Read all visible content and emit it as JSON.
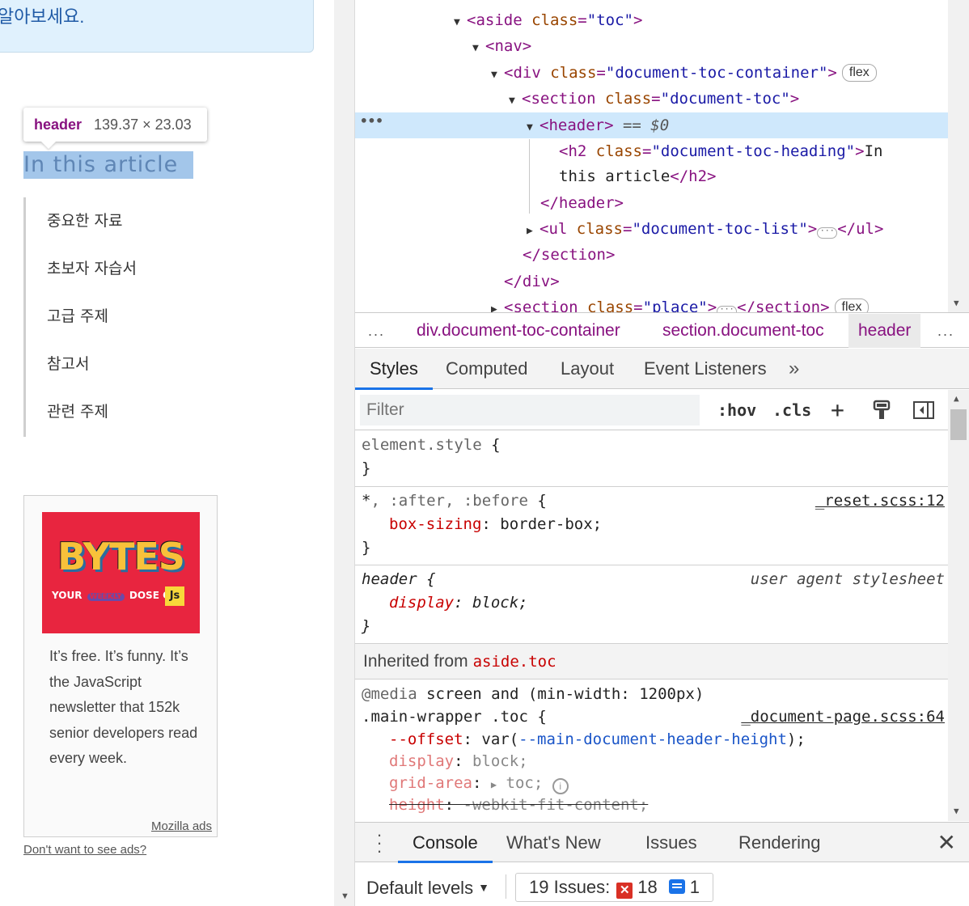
{
  "page": {
    "notice_text": "알아보세요.",
    "tooltip": {
      "tag": "header",
      "size": "139.37 × 23.03"
    },
    "toc_heading": "In this article",
    "toc_items": [
      "중요한 자료",
      "초보자 자습서",
      "고급 주제",
      "참고서",
      "관련 주제"
    ],
    "ad": {
      "brand_title": "BYTES",
      "tag_your": "YOUR",
      "tag_weekly": "WEEKLY",
      "tag_dose": "DOSE OF",
      "tag_js": "Js",
      "body": "It’s free. It’s funny. It’s the JavaScript newsletter that 152k senior developers read every week.",
      "sponsor": "Mozilla ads"
    },
    "ad_optout": "Don't want to see ads?"
  },
  "devtools": {
    "elements": {
      "l1": {
        "tag_open": "<aside",
        "attr": "class",
        "val": "\"toc\"",
        "close": ">"
      },
      "l2": {
        "tag": "<nav>"
      },
      "l3": {
        "tag_open": "<div",
        "attr": "class",
        "val": "\"document-toc-container\"",
        "close": ">",
        "badge": "flex"
      },
      "l4": {
        "tag_open": "<section",
        "attr": "class",
        "val": "\"document-toc\"",
        "close": ">"
      },
      "l5": {
        "tag": "<header>",
        "eq": "== $0"
      },
      "l6": {
        "tag_open": "<h2",
        "attr": "class",
        "val": "\"document-toc-heading\"",
        "close": ">",
        "text": "In"
      },
      "l7": {
        "text": "this article",
        "tag_close": "</h2>"
      },
      "l8": {
        "tag": "</header>"
      },
      "l9": {
        "tag_open": "<ul",
        "attr": "class",
        "val": "\"document-toc-list\"",
        "close": ">",
        "ellipsis": "···",
        "tag_close": "</ul>"
      },
      "l10": {
        "tag": "</section>"
      },
      "l11": {
        "tag": "</div>"
      },
      "l12": {
        "tag_open": "<section",
        "attr": "class",
        "val": "\"place\"",
        "close": ">",
        "ellipsis": "···",
        "tag_close": "</section>",
        "badge": "flex"
      },
      "row_menu": "•••"
    },
    "breadcrumbs": {
      "left_more": "...",
      "items": [
        "div.document-toc-container",
        "section.document-toc",
        "header"
      ],
      "right_more": "..."
    },
    "styles_tabs": [
      "Styles",
      "Computed",
      "Layout",
      "Event Listeners"
    ],
    "styles_tabs_more": "»",
    "filter": {
      "placeholder": "Filter",
      "hov": ":hov",
      "cls": ".cls",
      "plus": "+"
    },
    "rules": {
      "element_style": {
        "selector": "element.style",
        "open": "{",
        "close": "}"
      },
      "reset": {
        "selector": "*",
        "pseudo": ", :after, :before",
        "open": "{",
        "source": "_reset.scss:12",
        "prop": "box-sizing",
        "value": "border-box;",
        "close": "}"
      },
      "ua": {
        "selector": "header",
        "open": "{",
        "source": "user agent stylesheet",
        "prop": "display",
        "value": "block;",
        "close": "}"
      },
      "inherited_label": "Inherited from",
      "inherited_selector": "aside.toc",
      "media": {
        "at": "@media",
        "query": "screen and (min-width: 1200px)",
        "selector": ".main-wrapper .toc {",
        "source": "_document-page.scss:64",
        "p1": {
          "prop": "--offset",
          "pre": "var(",
          "var": "--main-document-header-height",
          "post": ");"
        },
        "p2": {
          "prop": "display",
          "value": "block;"
        },
        "p3": {
          "prop": "grid-area",
          "value": "toc;"
        },
        "p4": {
          "prop": "height",
          "value": "-webkit-fit-content;"
        }
      }
    },
    "drawer": {
      "tabs": [
        "Console",
        "What's New",
        "Issues",
        "Rendering"
      ],
      "close": "✕",
      "levels": "Default levels",
      "issues_label": "19 Issues:",
      "errors": "18",
      "infos": "1"
    }
  }
}
